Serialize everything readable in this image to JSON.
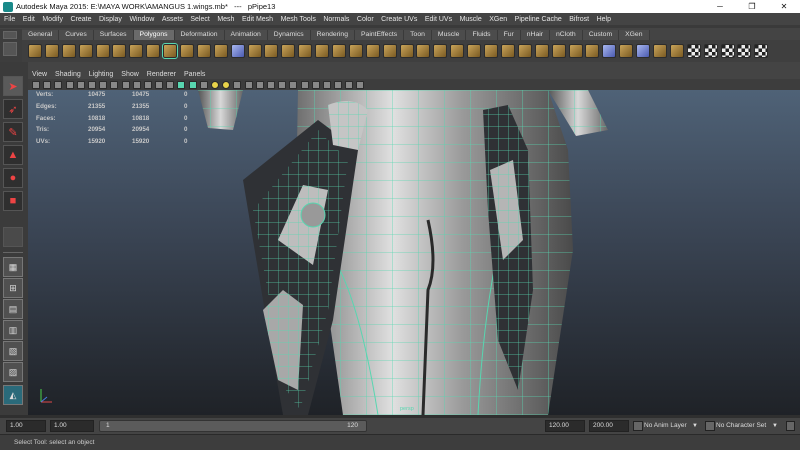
{
  "window": {
    "title": "Autodesk Maya 2015: E:\\MAYA WORK\\AMANGUS 1.wings.mb*   ---   pPipe13",
    "minimize": "─",
    "maximize": "❐",
    "close": "✕"
  },
  "menubar": [
    "File",
    "Edit",
    "Modify",
    "Create",
    "Display",
    "Window",
    "Assets",
    "Select",
    "Mesh",
    "Edit Mesh",
    "Mesh Tools",
    "Normals",
    "Color",
    "Create UVs",
    "Edit UVs",
    "Muscle",
    "XGen",
    "Pipeline Cache",
    "Bifrost",
    "Help"
  ],
  "shelf": {
    "tabs": [
      "General",
      "Curves",
      "Surfaces",
      "Polygons",
      "Deformation",
      "Animation",
      "Dynamics",
      "Rendering",
      "PaintEffects",
      "Toon",
      "Muscle",
      "Fluids",
      "Fur",
      "nHair",
      "nCloth",
      "Custom",
      "XGen"
    ],
    "active_tab": "Polygons"
  },
  "panel": {
    "menu": [
      "View",
      "Shading",
      "Lighting",
      "Show",
      "Renderer",
      "Panels"
    ]
  },
  "hud": {
    "rows": [
      {
        "label": "Verts:",
        "a": "10475",
        "b": "10475",
        "c": "0"
      },
      {
        "label": "Edges:",
        "a": "21355",
        "b": "21355",
        "c": "0"
      },
      {
        "label": "Faces:",
        "a": "10818",
        "b": "10818",
        "c": "0"
      },
      {
        "label": "Tris:",
        "a": "20954",
        "b": "20954",
        "c": "0"
      },
      {
        "label": "UVs:",
        "a": "15920",
        "b": "15920",
        "c": "0"
      }
    ]
  },
  "viewport": {
    "camera": "persp",
    "wire_color": "#58d6b0",
    "bg_top": "#4f6277",
    "bg_bottom": "#1f2227"
  },
  "range": {
    "start": "1.00",
    "playback_start": "1.00",
    "frame": "1",
    "slider_end": "120",
    "playback_end": "120.00",
    "end": "200.00",
    "anim_layer": "No Anim Layer",
    "character_set": "No Character Set"
  },
  "help": {
    "text": "Select Tool: select an object"
  }
}
